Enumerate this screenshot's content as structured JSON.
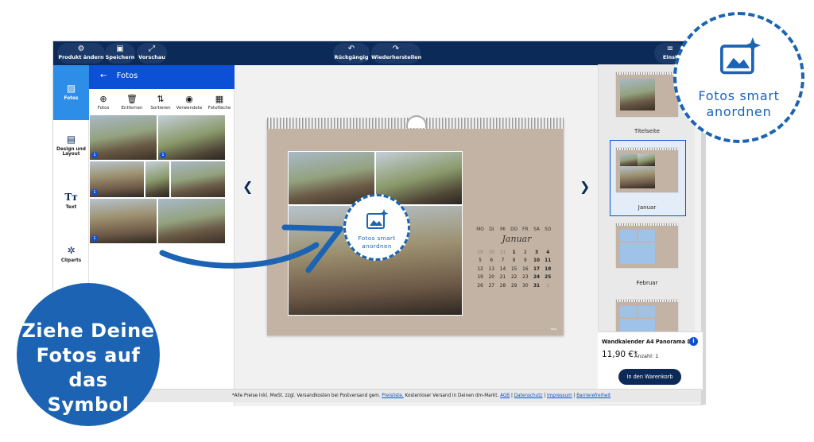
{
  "toolbar": {
    "product_change": "Produkt ändern",
    "save": "Speichern",
    "preview": "Vorschau",
    "undo": "Rückgängig",
    "redo": "Wiederherstellen",
    "settings_partial": "Einst"
  },
  "sidenav": {
    "items": [
      {
        "label": "Fotos",
        "icon": "image-icon"
      },
      {
        "label": "Design und Layout",
        "icon": "layout-icon"
      },
      {
        "label": "Text",
        "icon": "text-icon"
      },
      {
        "label": "Cliparts",
        "icon": "gear-icon"
      }
    ]
  },
  "panel": {
    "title": "Fotos",
    "tools": [
      "Fotos",
      "Entfernen",
      "Sortieren",
      "Verwendete",
      "Fotofläche"
    ],
    "badges": [
      "1",
      "1",
      "1",
      "1",
      "1"
    ]
  },
  "calendar": {
    "month": "Januar",
    "weekdays": [
      "MO",
      "DI",
      "MI",
      "DO",
      "FR",
      "SA",
      "SO"
    ],
    "weeks": [
      [
        "29",
        "30",
        "31",
        "1",
        "2",
        "3",
        "4"
      ],
      [
        "5",
        "6",
        "7",
        "8",
        "9",
        "10",
        "11"
      ],
      [
        "12",
        "13",
        "14",
        "15",
        "16",
        "17",
        "18"
      ],
      [
        "19",
        "20",
        "21",
        "22",
        "23",
        "24",
        "25"
      ],
      [
        "26",
        "27",
        "28",
        "29",
        "30",
        "31",
        "1"
      ]
    ],
    "brand": "foto"
  },
  "pages": {
    "items": [
      "Titelseite",
      "Januar",
      "Februar"
    ]
  },
  "cart": {
    "product": "Wandkalender A4 Panorama D...",
    "price": "11,90 €*",
    "quantity": "Anzahl: 1",
    "button": "In den Warenkorb"
  },
  "footer": {
    "text1": "*Alle Preise inkl. MwSt. zzgl. Versandkosten bei Postversand gem.",
    "link_preisliste": "Preisliste.",
    "text2": "Kostenloser Versand in Deinen dm-Markt.",
    "link_agb": "AGB",
    "link_datenschutz": "Datenschutz",
    "link_impressum": "Impressum",
    "link_barriere": "Barrierefreiheit"
  },
  "overlay": {
    "left_line1": "Ziehe Deine",
    "left_line2": "Fotos auf das",
    "left_line3": "Symbol",
    "smart_line1": "Fotos smart",
    "smart_line2": "anordnen",
    "target_line1": "Fotos smart",
    "target_line2": "anordnen"
  },
  "colors": {
    "navy": "#0c2a57",
    "blue": "#0c50d6",
    "accent": "#1c64b3",
    "calendar_bg": "#c3b3a4"
  }
}
